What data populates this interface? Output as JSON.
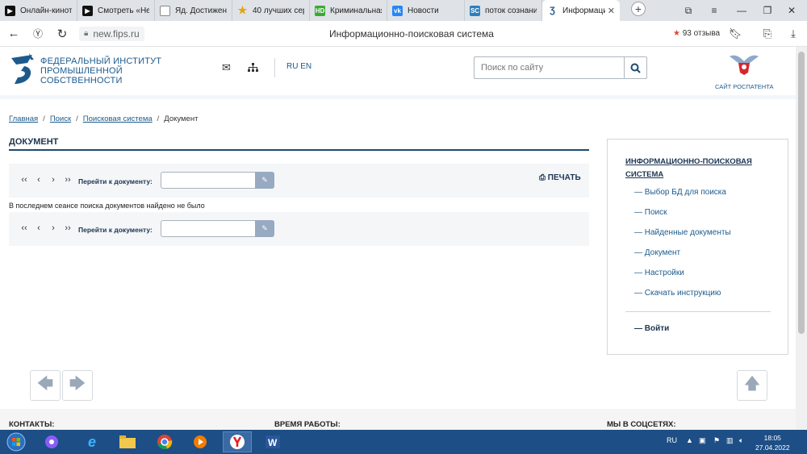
{
  "browser": {
    "tabs": [
      {
        "label": "Онлайн-кинотеатр",
        "icon": "play-icon",
        "color": "#111111"
      },
      {
        "label": "Смотреть «Не",
        "icon": "play-icon",
        "color": "#111111"
      },
      {
        "label": "Яд. Достижения",
        "icon": "page-icon",
        "color": "#ffffff"
      },
      {
        "label": "40 лучших сер",
        "icon": "star-icon",
        "color": "#e8a30c"
      },
      {
        "label": "Криминальная",
        "icon": "nd-icon",
        "color": "#3aa935"
      },
      {
        "label": "Новости",
        "icon": "vk-icon",
        "color": "#2787f5"
      },
      {
        "label": "поток сознания",
        "icon": "sc-icon",
        "color": "#2d7fbf"
      },
      {
        "label": "Информацион",
        "icon": "fips-icon",
        "color": "#1d5a8c",
        "active": true
      }
    ],
    "url": "new.fips.ru",
    "page_title": "Информационно-поисковая система",
    "reviews": "93 отзыва"
  },
  "site": {
    "institute_lines": [
      "Федеральный институт",
      "промышленной",
      "собственности"
    ],
    "lang": "RU EN",
    "search_placeholder": "Поиск по сайту",
    "rospatent_label": "САЙТ РОСПАТЕНТА"
  },
  "breadcrumbs": [
    "Главная",
    "Поиск",
    "Поисковая система",
    "Документ"
  ],
  "document": {
    "title": "ДОКУМЕНТ",
    "nav": [
      "‹‹",
      "‹",
      "›",
      "››"
    ],
    "goto_label": "Перейти к документу:",
    "print_label": "ПЕЧАТЬ",
    "message": "В последнем сеансе поиска документов найдено не было"
  },
  "sidebar": {
    "title": "ИНФОРМАЦИОННО-ПОИСКОВАЯ СИСТЕМА",
    "items": [
      "— Выбор БД для поиска",
      "— Поиск",
      "— Найденные документы",
      "— Документ",
      "— Настройки",
      "— Скачать инструкцию"
    ],
    "login": "— Войти"
  },
  "footer": {
    "contacts": "КОНТАКТЫ:",
    "hours": "ВРЕМЯ РАБОТЫ:",
    "social": "МЫ В СОЦСЕТЯХ:"
  },
  "taskbar": {
    "lang": "RU",
    "time": "18:05",
    "date": "27.04.2022"
  },
  "colors": {
    "accent": "#1d5a8c",
    "dark_blue": "#1d3552",
    "taskbar": "#1d4e86"
  }
}
